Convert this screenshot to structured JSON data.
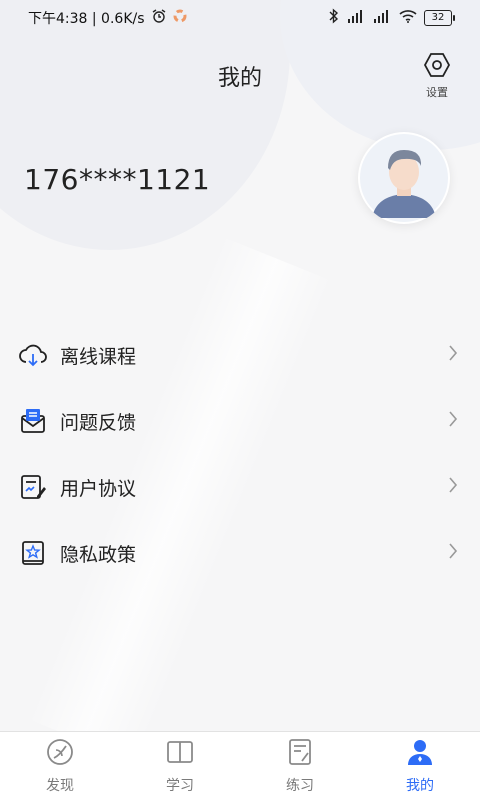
{
  "status": {
    "time_speed": "下午4:38 | 0.6K/s",
    "battery": "32"
  },
  "header": {
    "title": "我的",
    "settings_label": "设置"
  },
  "profile": {
    "phone": "176****1121"
  },
  "menu": [
    {
      "label": "离线课程",
      "icon": "cloud-download-icon"
    },
    {
      "label": "问题反馈",
      "icon": "feedback-icon"
    },
    {
      "label": "用户协议",
      "icon": "agreement-icon"
    },
    {
      "label": "隐私政策",
      "icon": "privacy-icon"
    }
  ],
  "tabs": [
    {
      "label": "发现",
      "icon": "discover-icon",
      "active": false
    },
    {
      "label": "学习",
      "icon": "book-icon",
      "active": false
    },
    {
      "label": "练习",
      "icon": "practice-icon",
      "active": false
    },
    {
      "label": "我的",
      "icon": "user-icon",
      "active": true
    }
  ],
  "colors": {
    "accent": "#2d6cf6",
    "text": "#222222",
    "inactive": "#7a7a7a"
  }
}
